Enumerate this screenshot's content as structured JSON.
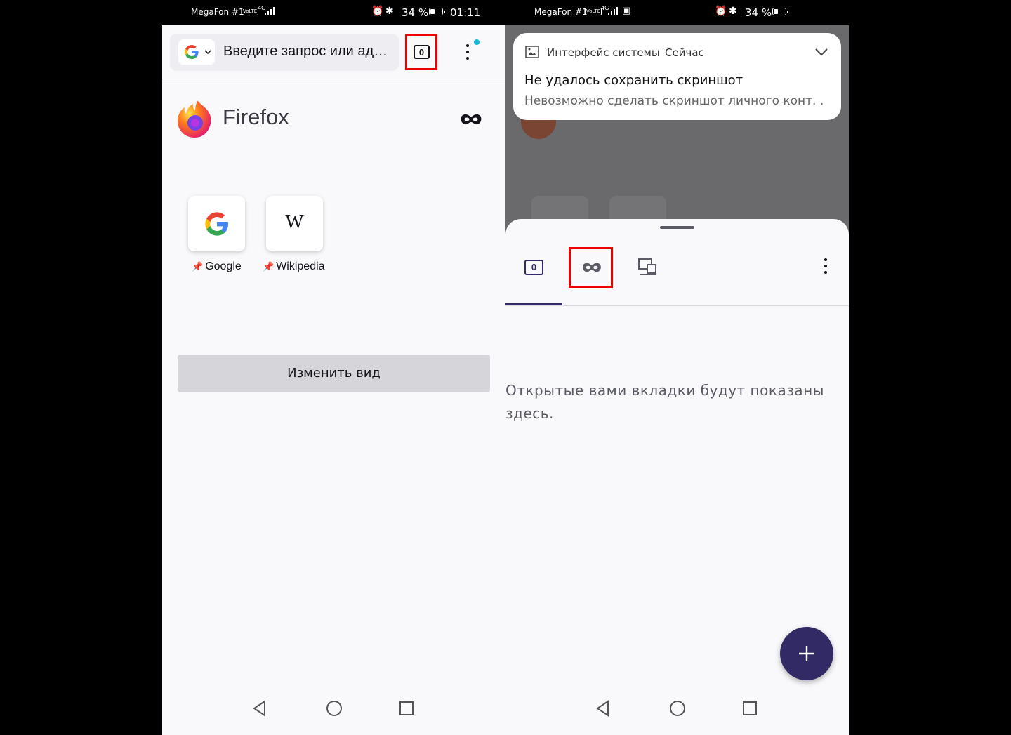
{
  "left_status": {
    "carrier": "MegaFon #1",
    "net": "VoLTE",
    "gen": "4G",
    "battery": "34 %",
    "time": "01:11"
  },
  "right_status": {
    "carrier": "MegaFon #1",
    "net": "VoLTE",
    "gen": "4G",
    "battery": "34 %"
  },
  "left": {
    "url_placeholder": "Введите запрос или ад…",
    "tab_count": "0",
    "brand": "Firefox",
    "shortcuts": [
      {
        "letter": "G",
        "label": "Google"
      },
      {
        "letter": "W",
        "label": "Wikipedia"
      }
    ],
    "customize_label": "Изменить вид"
  },
  "right": {
    "notification": {
      "app": "Интерфейс системы",
      "time": "Сейчас",
      "title": "Не удалось сохранить скриншот",
      "body": "Невозможно сделать скриншот личного конт. ."
    },
    "tab_count": "0",
    "empty_text": "Открытые вами вкладки будут показаны здесь."
  },
  "colors": {
    "accent": "#312a65",
    "highlight": "#e00000",
    "notification_dot": "#0fbcd6"
  }
}
